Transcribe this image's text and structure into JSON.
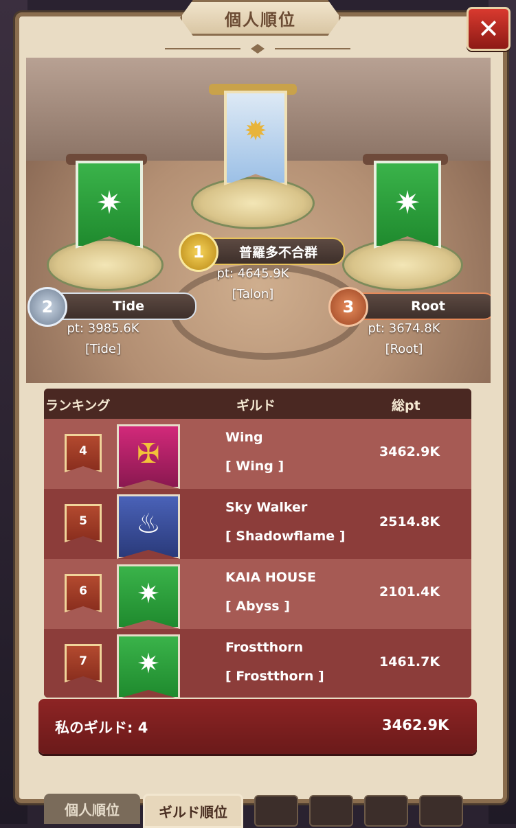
{
  "header": {
    "title": "個人順位"
  },
  "podium": [
    {
      "rank": "1",
      "name": "普羅多不合群",
      "pt": "pt:  4645.9K",
      "tag": "[Talon]"
    },
    {
      "rank": "2",
      "name": "Tide",
      "pt": "pt:  3985.6K",
      "tag": "[Tide]"
    },
    {
      "rank": "3",
      "name": "Root",
      "pt": "pt:  3674.8K",
      "tag": "[Root]"
    }
  ],
  "table": {
    "headers": {
      "rank": "ランキング",
      "guild": "ギルド",
      "points": "総pt"
    },
    "rows": [
      {
        "rank": "4",
        "name": "Wing",
        "tag": "[ Wing ]",
        "points": "3462.9K",
        "icon": "wing-crest-icon"
      },
      {
        "rank": "5",
        "name": "Sky Walker",
        "tag": "[ Shadowflame ]",
        "points": "2514.8K",
        "icon": "flame-crest-icon"
      },
      {
        "rank": "6",
        "name": "KAIA HOUSE",
        "tag": "[ Abyss ]",
        "points": "2101.4K",
        "icon": "star-banner-icon"
      },
      {
        "rank": "7",
        "name": "Frostthorn",
        "tag": "[ Frostthorn ]",
        "points": "1461.7K",
        "icon": "star-banner-icon"
      }
    ]
  },
  "my_guild": {
    "label": "私のギルド: 4",
    "points": "3462.9K"
  },
  "tabs": [
    {
      "label": "個人順位"
    },
    {
      "label": "ギルド順位"
    }
  ],
  "colors": {
    "accent": "#8d2424",
    "row_light": "#a65a54",
    "row_dark": "#8c3d3a"
  }
}
